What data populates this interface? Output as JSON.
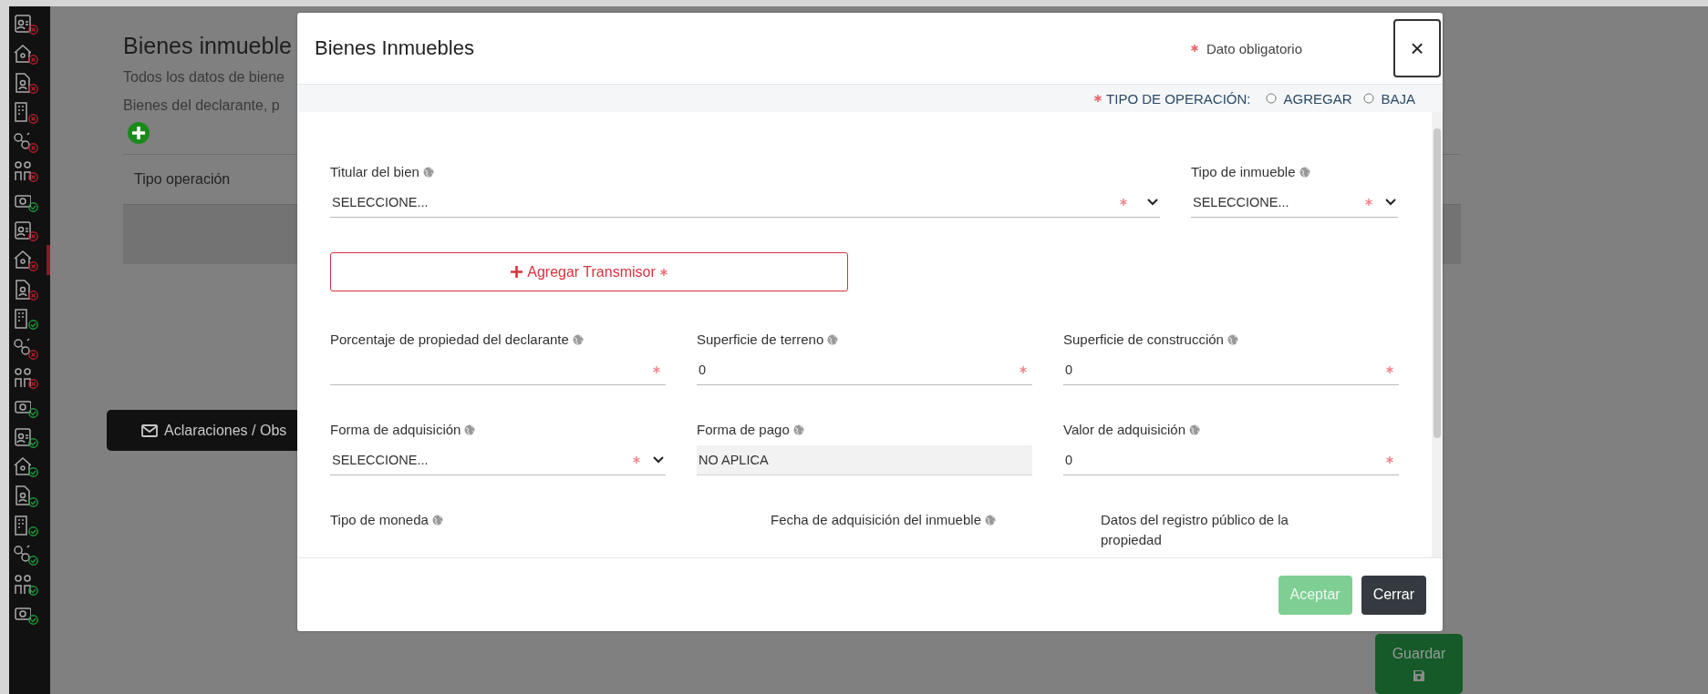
{
  "sidebar": {
    "items": [
      {
        "complete": false,
        "selected": false
      },
      {
        "complete": false,
        "selected": false
      },
      {
        "complete": false,
        "selected": false
      },
      {
        "complete": false,
        "selected": false
      },
      {
        "complete": false,
        "selected": false
      },
      {
        "complete": false,
        "selected": false
      },
      {
        "complete": true,
        "selected": false
      },
      {
        "complete": false,
        "selected": false
      },
      {
        "complete": false,
        "selected": true
      },
      {
        "complete": false,
        "selected": false
      },
      {
        "complete": true,
        "selected": false
      },
      {
        "complete": false,
        "selected": false
      },
      {
        "complete": false,
        "selected": false
      },
      {
        "complete": true,
        "selected": false
      },
      {
        "complete": true,
        "selected": false
      },
      {
        "complete": true,
        "selected": false
      },
      {
        "complete": true,
        "selected": false
      },
      {
        "complete": true,
        "selected": false
      },
      {
        "complete": true,
        "selected": false
      },
      {
        "complete": true,
        "selected": false
      },
      {
        "complete": true,
        "selected": false
      }
    ]
  },
  "page": {
    "title": "Bienes inmueble",
    "description": [
      "Todos los datos de biene",
      "Bienes del declarante, p"
    ],
    "table": {
      "columns": [
        "Tipo operación"
      ]
    },
    "notes_button": "Aclaraciones / Obs",
    "save_button": "Guardar"
  },
  "modal": {
    "title": "Bienes Inmuebles",
    "required_note": "Dato obligatorio",
    "close_label": "×",
    "operation": {
      "label": "TIPO DE OPERACIÓN:",
      "required": true,
      "options": [
        {
          "label": "AGREGAR",
          "selected": false
        },
        {
          "label": "BAJA",
          "selected": false
        }
      ]
    },
    "rows": [
      {
        "kind": "fields",
        "fields": [
          {
            "kind": "select",
            "label": "Titular del bien",
            "info": true,
            "value": "SELECCIONE...",
            "required": true
          },
          {
            "kind": "select",
            "label": "Tipo de inmueble",
            "info": true,
            "value": "SELECCIONE...",
            "required": true
          }
        ]
      },
      {
        "kind": "button",
        "label": "Agregar Transmisor",
        "required": true
      },
      {
        "kind": "fields",
        "fields": [
          {
            "kind": "input",
            "label": "Porcentaje de propiedad del declarante",
            "info": true,
            "required": true
          },
          {
            "kind": "input",
            "label": "Superficie de terreno",
            "info": true,
            "value": "0",
            "required": true
          },
          {
            "kind": "input",
            "label": "Superficie de construcción",
            "info": true,
            "value": "0",
            "required": true
          }
        ]
      },
      {
        "kind": "fields",
        "fields": [
          {
            "kind": "select",
            "label": "Forma de adquisición",
            "info": true,
            "value": "SELECCIONE...",
            "required": true
          },
          {
            "kind": "readonly",
            "label": "Forma de pago",
            "info": true,
            "value": "NO APLICA",
            "required": false
          },
          {
            "kind": "input",
            "label": "Valor de adquisición",
            "info": true,
            "value": "0",
            "required": true
          }
        ]
      },
      {
        "kind": "fields",
        "fields": [
          {
            "kind": "hidden",
            "label": "Tipo de moneda",
            "info": true
          },
          {
            "kind": "hidden",
            "label": "Fecha de adquisición del inmueble",
            "info": true
          },
          {
            "kind": "hidden",
            "label": "Datos del registro público de la propiedad",
            "info": false
          }
        ]
      }
    ],
    "buttons": [
      {
        "label": "Aceptar",
        "disabled": true
      },
      {
        "label": "Cerrar",
        "disabled": false
      }
    ]
  }
}
